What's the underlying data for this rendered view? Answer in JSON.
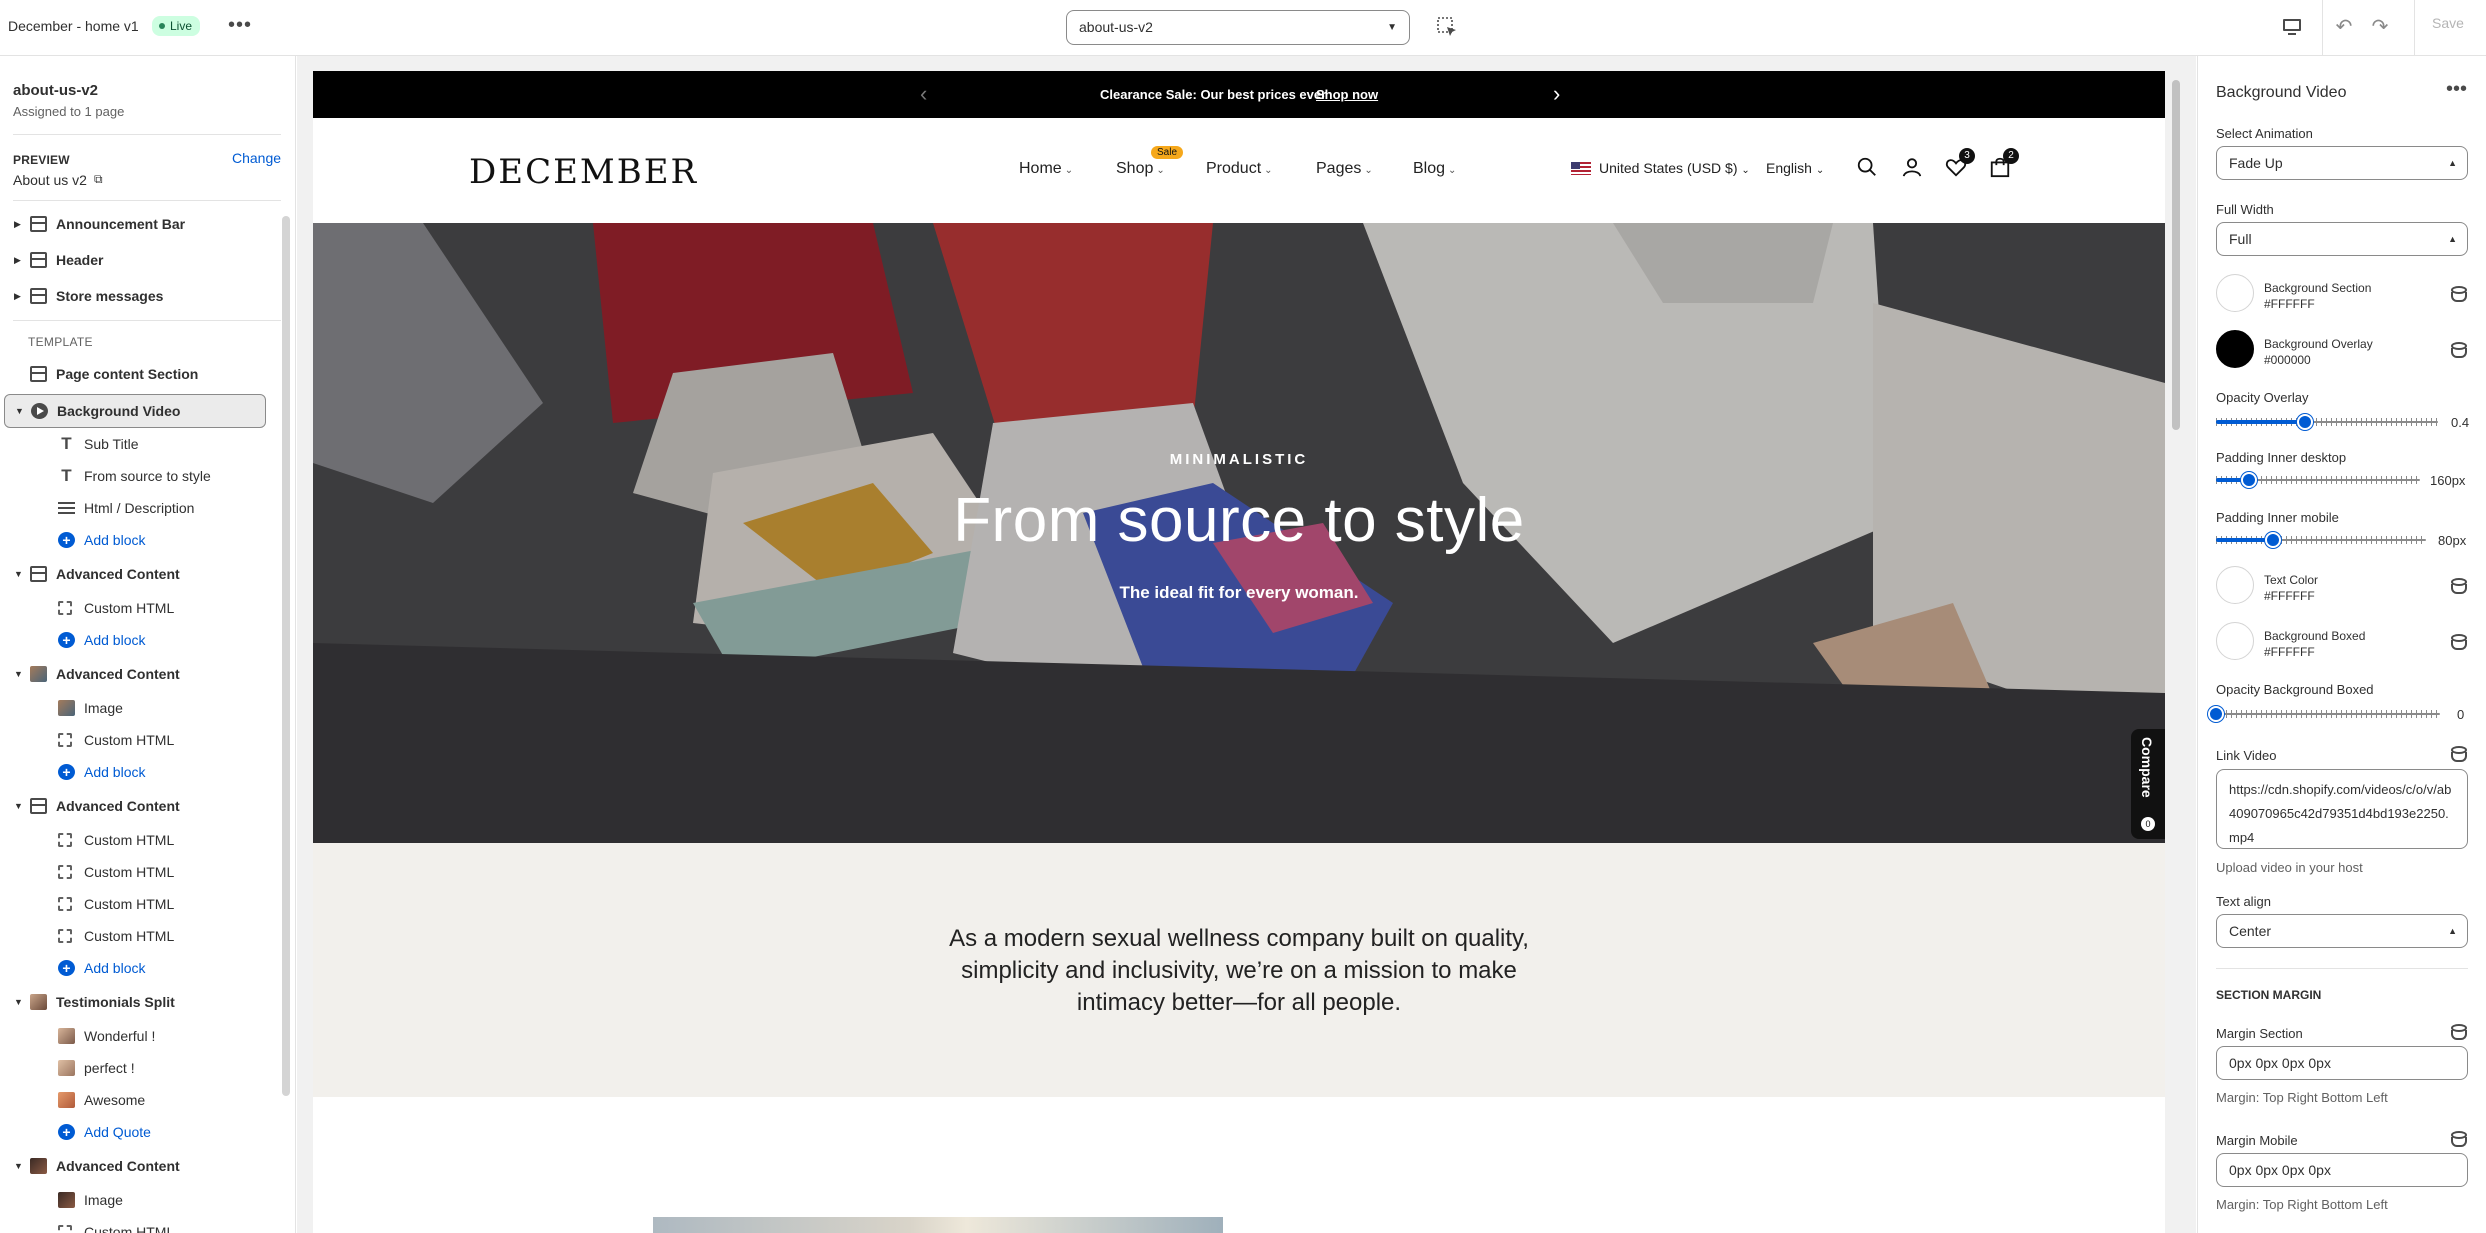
{
  "topbar": {
    "title": "December - home v1",
    "live_label": "Live",
    "template_select": "about-us-v2",
    "save_label": "Save"
  },
  "left": {
    "template_name": "about-us-v2",
    "assigned": "Assigned to 1 page",
    "preview_label": "PREVIEW",
    "change_label": "Change",
    "preview_page": "About us v2",
    "header_sections": [
      "Announcement Bar",
      "Header",
      "Store messages"
    ],
    "template_label": "TEMPLATE",
    "page_content": "Page content Section",
    "bg_video": "Background Video",
    "bg_video_blocks": [
      "Sub Title",
      "From source to style",
      "Html / Description"
    ],
    "add_block": "Add block",
    "advanced_content": "Advanced Content",
    "custom_html": "Custom HTML",
    "image": "Image",
    "testimonials": "Testimonials Split",
    "quotes": [
      "Wonderful !",
      "perfect !",
      "Awesome"
    ],
    "add_quote": "Add Quote"
  },
  "preview": {
    "announcement": "Clearance Sale: Our best prices ever",
    "announcement_link": "Shop now",
    "logo": "DECEMBER",
    "nav": [
      "Home",
      "Shop",
      "Product",
      "Pages",
      "Blog"
    ],
    "sale_badge": "Sale",
    "country": "United States (USD $)",
    "language": "English",
    "wishlist_count": "3",
    "cart_count": "2",
    "hero_sub": "MINIMALISTIC",
    "hero_heading": "From source to style",
    "hero_text": "The ideal fit for every woman.",
    "compare_label": "Compare",
    "compare_count": "0",
    "mission_lines": [
      "As a modern sexual wellness company built on quality,",
      "simplicity and inclusivity, we’re on a mission to make",
      "intimacy better—for all people."
    ]
  },
  "right": {
    "title": "Background Video",
    "select_animation_label": "Select Animation",
    "select_animation_value": "Fade Up",
    "full_width_label": "Full Width",
    "full_width_value": "Full",
    "bg_section_label": "Background Section",
    "bg_section_hex": "#FFFFFF",
    "bg_overlay_label": "Background Overlay",
    "bg_overlay_hex": "#000000",
    "opacity_overlay_label": "Opacity Overlay",
    "opacity_overlay_value": "0.4",
    "opacity_overlay_fraction": 0.4,
    "pad_desktop_label": "Padding Inner desktop",
    "pad_desktop_value": "160px",
    "pad_desktop_fraction": 0.16,
    "pad_mobile_label": "Padding Inner mobile",
    "pad_mobile_value": "80px",
    "pad_mobile_fraction": 0.27,
    "text_color_label": "Text Color",
    "text_color_hex": "#FFFFFF",
    "bg_boxed_label": "Background Boxed",
    "bg_boxed_hex": "#FFFFFF",
    "opacity_boxed_label": "Opacity Background Boxed",
    "opacity_boxed_value": "0",
    "link_video_label": "Link Video",
    "link_video_value": "https://cdn.shopify.com/videos/c/o/v/ab409070965c42d79351d4bd193e2250.mp4",
    "link_video_help": "Upload video in your host",
    "text_align_label": "Text align",
    "text_align_value": "Center",
    "section_margin_heading": "SECTION MARGIN",
    "margin_section_label": "Margin Section",
    "margin_section_value": "0px 0px 0px 0px",
    "margin_help": "Margin: Top Right Bottom Left",
    "margin_mobile_label": "Margin Mobile",
    "margin_mobile_value": "0px 0px 0px 0px",
    "margin_mobile_help": "Margin: Top Right Bottom Left"
  },
  "colors": {
    "accent": "#005bd3",
    "announcement_bg": "#000000",
    "beige_bg": "#f2f0ec",
    "sale_badge": "#f6a81b"
  }
}
